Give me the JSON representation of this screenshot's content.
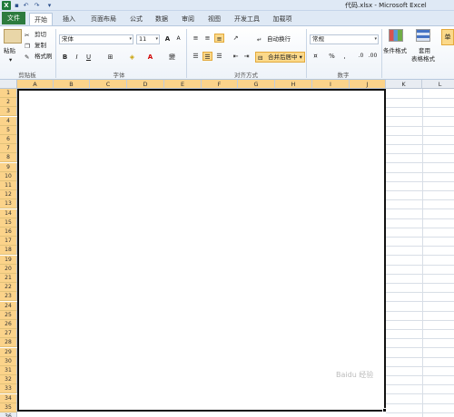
{
  "window": {
    "title": "代码.xlsx - Microsoft Excel"
  },
  "qat": {
    "save_icon": "save-icon",
    "undo_icon": "undo-icon",
    "redo_icon": "redo-icon"
  },
  "tabs": [
    {
      "label": "文件"
    },
    {
      "label": "开始"
    },
    {
      "label": "插入"
    },
    {
      "label": "页面布局"
    },
    {
      "label": "公式"
    },
    {
      "label": "数据"
    },
    {
      "label": "审阅"
    },
    {
      "label": "视图"
    },
    {
      "label": "开发工具"
    },
    {
      "label": "加载项"
    }
  ],
  "clipboard": {
    "paste": "粘贴",
    "cut": "剪切",
    "copy": "复制",
    "format_painter": "格式刷",
    "group": "剪贴板"
  },
  "font": {
    "name": "宋体",
    "size": "11",
    "bold": "B",
    "italic": "I",
    "underline": "U",
    "grow": "A",
    "shrink": "A",
    "group": "字体",
    "wen": "變"
  },
  "alignment": {
    "wrap_text": "自动换行",
    "merge_center": "合并后居中",
    "group": "对齐方式"
  },
  "number": {
    "format": "常规",
    "percent": "%",
    "comma": ",",
    "group": "数字"
  },
  "styles": {
    "conditional": "条件格式",
    "table_format_1": "套用",
    "table_format_2": "表格格式",
    "cell_style": "单"
  },
  "sheet": {
    "columns": [
      "A",
      "B",
      "C",
      "D",
      "E",
      "F",
      "G",
      "H",
      "I",
      "J",
      "K",
      "L"
    ],
    "rows": [
      "1",
      "2",
      "3",
      "4",
      "5",
      "6",
      "7",
      "8",
      "9",
      "10",
      "11",
      "12",
      "13",
      "14",
      "15",
      "16",
      "17",
      "18",
      "19",
      "20",
      "21",
      "22",
      "23",
      "24",
      "25",
      "26",
      "27",
      "28",
      "29",
      "30",
      "31",
      "32",
      "33",
      "34",
      "35",
      "36"
    ]
  },
  "watermark": "Baidu 经验",
  "colors": {
    "file_tab": "#2d7b3e",
    "selected_header": "#fbd38a",
    "ribbon_bg": "#dfe9f5"
  }
}
